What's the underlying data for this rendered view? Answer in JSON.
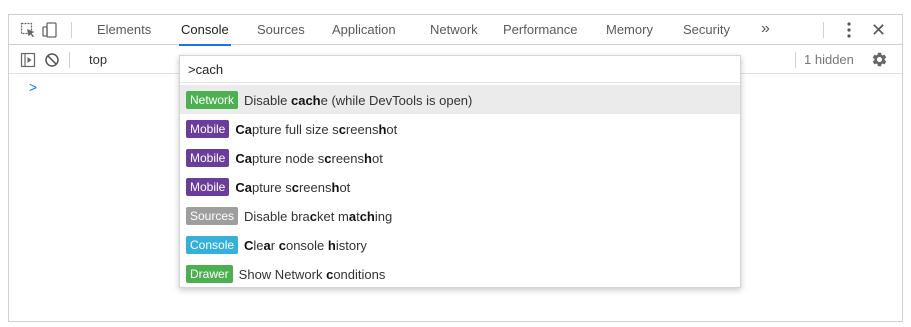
{
  "tabbar": {
    "tabs": [
      {
        "label": "Elements",
        "active": false
      },
      {
        "label": "Console",
        "active": true
      },
      {
        "label": "Sources",
        "active": false
      },
      {
        "label": "Application",
        "active": false
      },
      {
        "label": "Network",
        "active": false
      },
      {
        "label": "Performance",
        "active": false
      },
      {
        "label": "Memory",
        "active": false
      },
      {
        "label": "Security",
        "active": false
      }
    ],
    "more_label": "»",
    "close_label": "✕",
    "icons": [
      "inspect-element-icon",
      "device-toolbar-icon",
      "more-tabs-icon",
      "kebab-menu-icon",
      "close-icon"
    ]
  },
  "toolbar": {
    "context": "top",
    "hidden_count": "1 hidden",
    "icons": [
      "show-drawer-icon",
      "clear-console-icon",
      "settings-gear-icon"
    ]
  },
  "console": {
    "prompt": ">"
  },
  "command_menu": {
    "query": ">cach",
    "items": [
      {
        "badge": "Network",
        "badge_color": "#4caf50",
        "title": "Disable cache (while DevTools is open)",
        "selected": true
      },
      {
        "badge": "Mobile",
        "badge_color": "#6a3d9a",
        "title": "Capture full size screenshot",
        "selected": false
      },
      {
        "badge": "Mobile",
        "badge_color": "#6a3d9a",
        "title": "Capture node screenshot",
        "selected": false
      },
      {
        "badge": "Mobile",
        "badge_color": "#6a3d9a",
        "title": "Capture screenshot",
        "selected": false
      },
      {
        "badge": "Sources",
        "badge_color": "#9e9e9e",
        "title": "Disable bracket matching",
        "selected": false
      },
      {
        "badge": "Console",
        "badge_color": "#35b0d8",
        "title": "Clear console history",
        "selected": false
      },
      {
        "badge": "Drawer",
        "badge_color": "#4caf50",
        "title": "Show Network conditions",
        "selected": false
      }
    ]
  },
  "colors": {
    "accent": "#1a73e8",
    "selected_row": "#ebebeb",
    "border": "#d0d0d0"
  }
}
